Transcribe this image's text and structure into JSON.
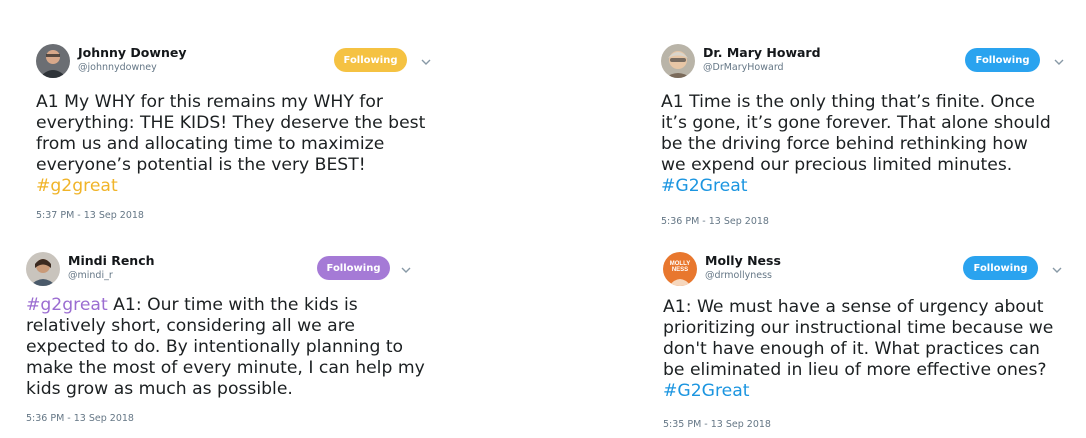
{
  "tweets": [
    {
      "name": "Johnny Downey",
      "handle": "@johnnydowney",
      "follow_label": "Following",
      "button_color": "#f5c242",
      "hashtag_color": "#f0b429",
      "text_before": "A1 My WHY for this remains my WHY for\neverything: THE KIDS! They deserve the best\nfrom us and allocating time to maximize\neveryone’s potential is the very BEST!\n",
      "hashtag": "#g2great",
      "text_after": "",
      "time": "5:37 PM - 13 Sep 2018"
    },
    {
      "name": "Mindi Rench",
      "handle": "@mindi_r",
      "follow_label": "Following",
      "button_color": "#a57ad6",
      "hashtag_color": "#9b6dd1",
      "text_before": "",
      "hashtag": "#g2great",
      "text_after": " A1: Our time with the kids is\nrelatively short, considering all we are\nexpected to do.  By intentionally planning to\nmake the most of every minute, I can help my\nkids grow as much as possible.",
      "time": "5:36 PM - 13 Sep 2018"
    },
    {
      "name": "Dr. Mary Howard",
      "handle": "@DrMaryHoward",
      "follow_label": "Following",
      "button_color": "#2aa3ef",
      "hashtag_color": "#1b95e0",
      "text_before": "A1 Time is the only thing that’s finite. Once\nit’s gone, it’s gone forever. That alone should\nbe the driving force behind rethinking how\nwe expend our precious limited minutes.\n",
      "hashtag": "#G2Great",
      "text_after": "",
      "time": "5:36 PM - 13 Sep 2018"
    },
    {
      "name": "Molly Ness",
      "handle": "@drmollyness",
      "follow_label": "Following",
      "button_color": "#2aa3ef",
      "hashtag_color": "#1b95e0",
      "avatar_text": "MOLLY NESS",
      "text_before": "A1: We must have a sense of urgency about\nprioritizing our instructional time because we\ndon't have enough of it. What practices can\nbe eliminated in lieu of more effective ones?\n",
      "hashtag": "#G2Great",
      "text_after": "",
      "time": "5:35 PM - 13 Sep 2018"
    }
  ]
}
